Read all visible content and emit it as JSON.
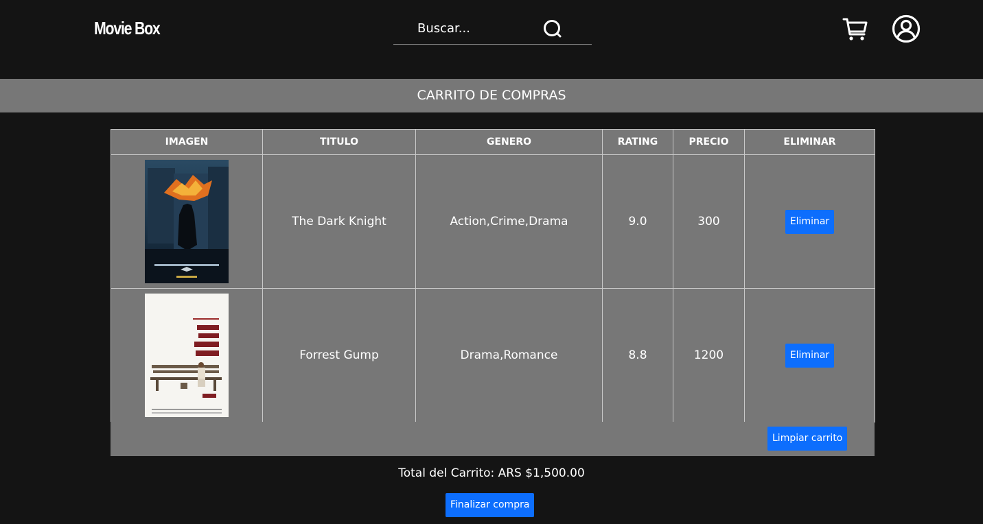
{
  "header": {
    "logo": "Movie Box",
    "search_placeholder": "Buscar..."
  },
  "banner": {
    "title": "CARRITO DE COMPRAS"
  },
  "table": {
    "columns": [
      "IMAGEN",
      "TITULO",
      "GENERO",
      "RATING",
      "PRECIO",
      "ELIMINAR"
    ],
    "rows": [
      {
        "poster": "dark-knight-poster",
        "title": "The Dark Knight",
        "genre": "Action,Crime,Drama",
        "rating": "9.0",
        "price": "300",
        "delete_label": "Eliminar"
      },
      {
        "poster": "forrest-gump-poster",
        "title": "Forrest Gump",
        "genre": "Drama,Romance",
        "rating": "8.8",
        "price": "1200",
        "delete_label": "Eliminar"
      }
    ]
  },
  "clear_cart_label": "Limpiar carrito",
  "total_text": "Total del Carrito: ARS $1,500.00",
  "finish_label": "Finalizar compra",
  "colors": {
    "background": "#141414",
    "panel": "#777777",
    "button": "#0d6efd"
  }
}
